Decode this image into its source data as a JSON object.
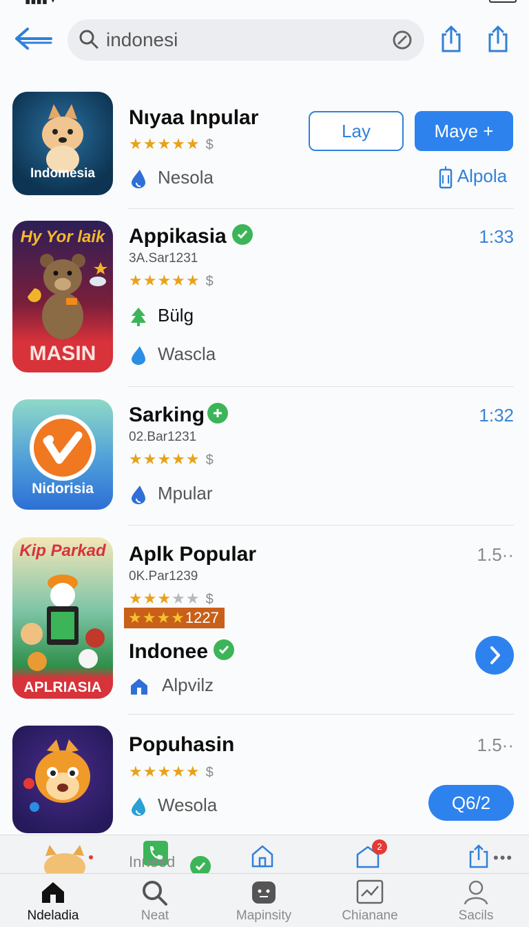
{
  "colors": {
    "accent": "#2d82ee",
    "verified": "#3cb559",
    "star": "#e8a21a"
  },
  "search": {
    "query": "indonesi"
  },
  "results": [
    {
      "icon_caption": "Indomesia",
      "name": "Nιyaa Inpular",
      "stars": "★★★★★",
      "price": "$",
      "developer": "Nesola",
      "btn_outline": "Lay",
      "btn_solid": "Maye +",
      "link": "Alpola"
    },
    {
      "icon_top": "Hy Yor laik",
      "icon_caption": "MASIN",
      "name": "Appikasia",
      "meta": "3A.Sar1231",
      "stars": "★★★★★",
      "price": "$",
      "category": "Bülg",
      "developer": "Wascla",
      "time": "1:33"
    },
    {
      "icon_caption": "Nidorisia",
      "name": "Sarking",
      "meta": "02.Bar1231",
      "stars": "★★★★★",
      "price": "$",
      "developer": "Mpular",
      "time": "1:32"
    },
    {
      "icon_top": "Kip Parkad",
      "icon_caption": "APLRIASIA",
      "name": "Aplk Popular",
      "meta": "0K.Par1239",
      "stars": "★★★",
      "stars_dim": "★★",
      "price": "$",
      "rating_tag_stars": "★★★★",
      "rating_tag_value": "1227",
      "sub_name": "Indonee",
      "developer": "Alpvilz",
      "time": "1.5··"
    },
    {
      "name": "Popuhasin",
      "stars": "★★★★★",
      "price": "$",
      "developer": "Wesola",
      "time": "1.5··",
      "pill": "Q6/2"
    }
  ],
  "subbar": {
    "label": "Inneed",
    "badge": "2"
  },
  "tabs": [
    {
      "label": "Ndeladia",
      "icon": "home-icon"
    },
    {
      "label": "Neat",
      "icon": "search-icon"
    },
    {
      "label": "Mapinsity",
      "icon": "face-icon"
    },
    {
      "label": "Chianane",
      "icon": "chart-icon"
    },
    {
      "label": "Sacils",
      "icon": "person-icon"
    }
  ]
}
